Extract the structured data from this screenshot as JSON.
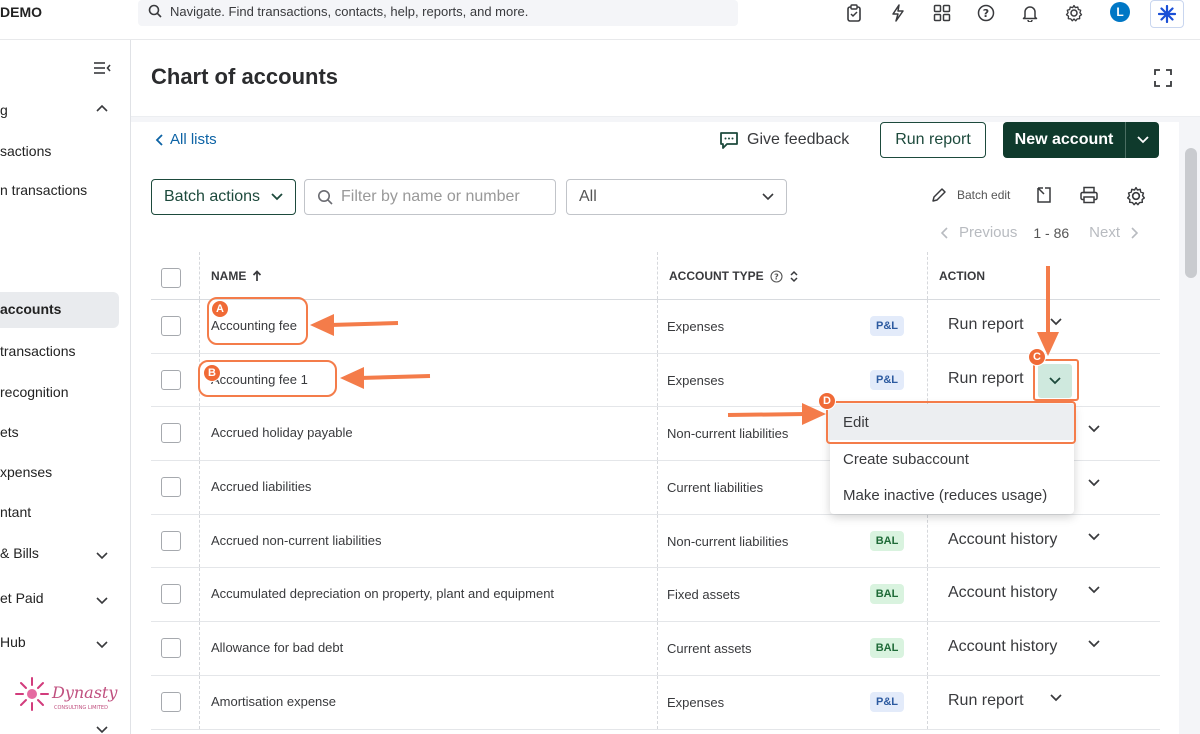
{
  "topbar": {
    "company": "DEMO",
    "search_placeholder": "Navigate. Find transactions, contacts, help, reports, and more.",
    "avatar_letter": "L"
  },
  "sidebar": {
    "items": [
      {
        "label": "g",
        "chevron": true
      },
      {
        "label": "sactions"
      },
      {
        "label": "n transactions"
      },
      {
        "label": "accounts",
        "active": true
      },
      {
        "label": "transactions"
      },
      {
        "label": "recognition"
      },
      {
        "label": "ets"
      },
      {
        "label": "xpenses"
      },
      {
        "label": "ntant"
      },
      {
        "label": "& Bills",
        "chevron": true
      },
      {
        "label": "et Paid",
        "chevron": true
      },
      {
        "label": "Hub",
        "chevron": true
      }
    ],
    "logo_text": "Dynasty",
    "logo_sub": "CONSULTING LIMITED"
  },
  "page": {
    "title": "Chart of accounts",
    "back_label": "All lists",
    "feedback_label": "Give feedback",
    "run_report_label": "Run report",
    "new_account_label": "New account"
  },
  "toolbar": {
    "batch_actions_label": "Batch actions",
    "filter_placeholder": "Filter by name or number",
    "select_value": "All",
    "batch_edit_label": "Batch edit"
  },
  "pager": {
    "previous": "Previous",
    "range": "1 - 86",
    "next": "Next"
  },
  "table": {
    "headers": {
      "name": "NAME",
      "type": "ACCOUNT TYPE",
      "action": "ACTION"
    },
    "rows": [
      {
        "name": "Accounting fee",
        "type": "Expenses",
        "badge": "P&L",
        "action": "Run report"
      },
      {
        "name": "Accounting fee 1",
        "type": "Expenses",
        "badge": "P&L",
        "action": "Run report"
      },
      {
        "name": "Accrued holiday payable",
        "type": "Non-current liabilities",
        "badge": "",
        "action": ""
      },
      {
        "name": "Accrued liabilities",
        "type": "Current liabilities",
        "badge": "",
        "action": ""
      },
      {
        "name": "Accrued non-current liabilities",
        "type": "Non-current liabilities",
        "badge": "BAL",
        "action": "Account history"
      },
      {
        "name": "Accumulated depreciation on property, plant and equipment",
        "type": "Fixed assets",
        "badge": "BAL",
        "action": "Account history"
      },
      {
        "name": "Allowance for bad debt",
        "type": "Current assets",
        "badge": "BAL",
        "action": "Account history"
      },
      {
        "name": "Amortisation expense",
        "type": "Expenses",
        "badge": "P&L",
        "action": "Run report"
      }
    ]
  },
  "menu": {
    "items": [
      {
        "label": "Edit"
      },
      {
        "label": "Create subaccount"
      },
      {
        "label": "Make inactive (reduces usage)"
      }
    ]
  },
  "annotations": {
    "a": "A",
    "b": "B",
    "c": "C",
    "d": "D"
  },
  "colors": {
    "brand_dark": "#0f3a2c",
    "link": "#0d63a5",
    "annotation": "#f47c4a"
  }
}
